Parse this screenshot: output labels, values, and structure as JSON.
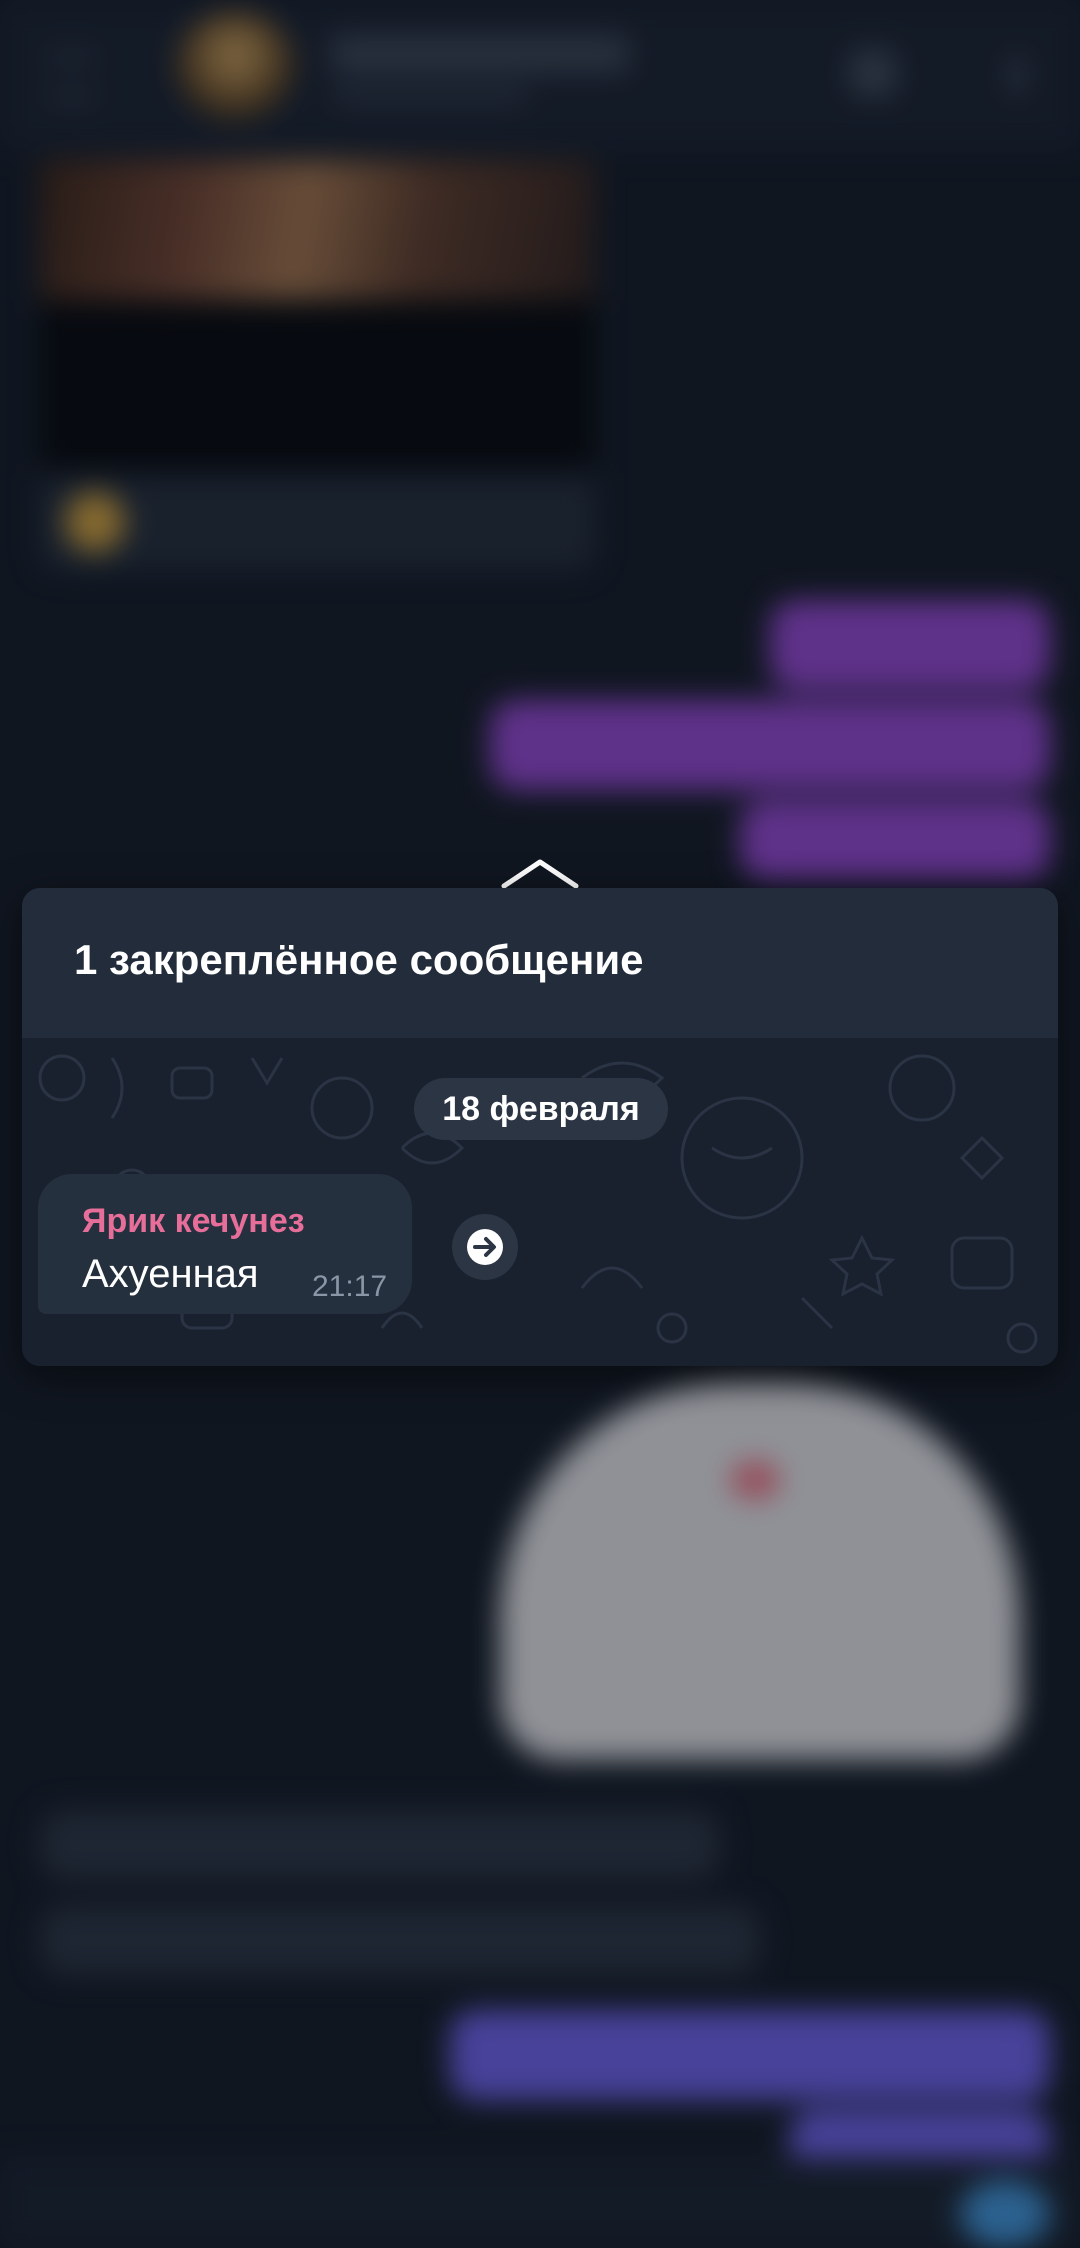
{
  "pinned_panel": {
    "title": "1 закреплённое сообщение",
    "date_chip": "18 февраля",
    "message": {
      "sender": "Ярик кечунез",
      "text": "Ахуенная",
      "time": "21:17"
    }
  },
  "colors": {
    "background": "#141b26",
    "panel_header": "#222c3a",
    "panel_body": "#18212d",
    "bubble": "#25303f",
    "sender_name": "#e86e9a",
    "outgoing_purple": "#8e45c8",
    "outgoing_blue": "#6a5ee0"
  },
  "icons": {
    "collapse": "chevron-up-icon",
    "forward": "arrow-right-icon",
    "back": "menu-icon",
    "call": "phone-icon",
    "more": "more-vertical-icon"
  }
}
